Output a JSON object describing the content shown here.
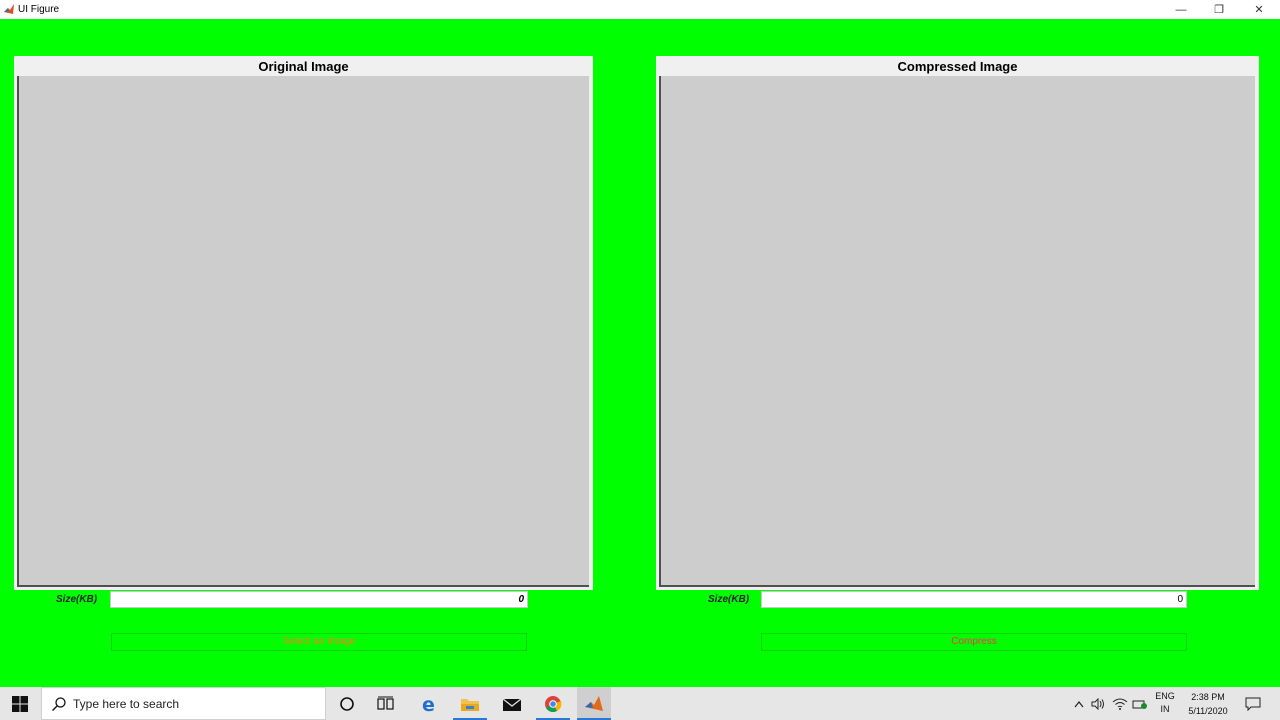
{
  "window": {
    "title": "UI Figure",
    "minimize_glyph": "—",
    "maximize_glyph": "❐",
    "close_glyph": "✕"
  },
  "colors": {
    "background": "#00ff00",
    "panel": "#f0f0f0",
    "axes": "#cdcdcd",
    "select_button_text": "#ff7d2a",
    "compress_button_text": "#ff3050"
  },
  "original_panel": {
    "title": "Original Image",
    "size_label": "Size(KB)",
    "size_value": "0",
    "button_label": "Select an Image"
  },
  "compressed_panel": {
    "title": "Compressed Image",
    "size_label": "Size(KB)",
    "size_value": "0",
    "button_label": "Compress"
  },
  "taskbar": {
    "search_placeholder": "Type here to search",
    "icons": [
      "windows-start-icon",
      "cortana-icon",
      "task-view-icon",
      "edge-icon",
      "file-explorer-icon",
      "mail-icon",
      "chrome-icon",
      "matlab-icon"
    ],
    "language_line1": "ENG",
    "language_line2": "IN",
    "time": "2:38 PM",
    "date": "5/11/2020"
  }
}
